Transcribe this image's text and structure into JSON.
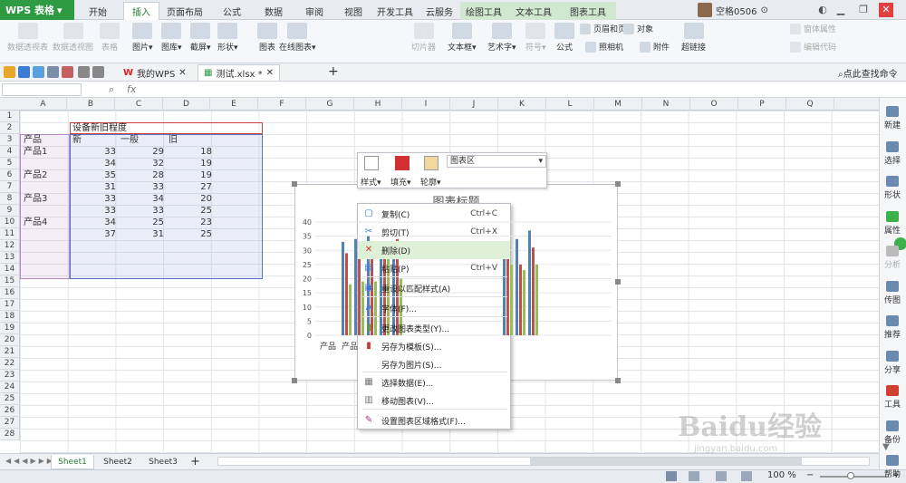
{
  "app": {
    "brand": "WPS 表格",
    "menu_arrow": "▾"
  },
  "tabs": [
    "开始",
    "插入",
    "页面布局",
    "公式",
    "数据",
    "审阅",
    "视图",
    "开发工具",
    "云服务",
    "绘图工具",
    "文本工具",
    "图表工具"
  ],
  "active_tab": "插入",
  "user": {
    "name": "空格0506"
  },
  "ribbon": {
    "buttons": [
      "数据透视表",
      "数据透视图",
      "表格",
      "图片▾",
      "图库▾",
      "截屏▾",
      "形状▾",
      "图表",
      "在线图表▾",
      "切片器",
      "文本框▾",
      "艺术字▾",
      "符号▾",
      "公式",
      "页眉和页脚",
      "对象",
      "照相机",
      "附件",
      "超链接",
      "窗体属性",
      "编辑代码"
    ]
  },
  "quickbar": {
    "doc_tabs": [
      {
        "label": "我的WPS"
      },
      {
        "label": "测试.xlsx *"
      }
    ],
    "search": "点此查找命令"
  },
  "formula": {
    "fx": "fx"
  },
  "columns": [
    "A",
    "B",
    "C",
    "D",
    "E",
    "F",
    "G",
    "H",
    "I",
    "J",
    "K",
    "L",
    "M",
    "N",
    "O",
    "P",
    "Q"
  ],
  "rows": [
    "1",
    "2",
    "3",
    "4",
    "5",
    "6",
    "7",
    "8",
    "9",
    "10",
    "11",
    "12",
    "13",
    "14",
    "15",
    "16",
    "17",
    "18",
    "19",
    "20",
    "21",
    "22",
    "23",
    "24",
    "25",
    "26",
    "27",
    "28"
  ],
  "sheet": {
    "title": "设备新旧程度",
    "headers": [
      "产品",
      "新",
      "一般",
      "旧"
    ],
    "products": [
      "产品1",
      "产品2",
      "产品3",
      "产品4"
    ],
    "data": [
      [
        33,
        29,
        18
      ],
      [
        34,
        32,
        19
      ],
      [
        35,
        28,
        19
      ],
      [
        31,
        33,
        27
      ],
      [
        33,
        34,
        20
      ],
      [
        33,
        33,
        25
      ],
      [
        34,
        25,
        23
      ],
      [
        37,
        31,
        25
      ]
    ]
  },
  "chart": {
    "title": "图表标题",
    "ticks": [
      "40",
      "35",
      "30",
      "25",
      "20",
      "15",
      "10",
      "5",
      "0"
    ],
    "xlabels": [
      "产品",
      "产品"
    ]
  },
  "floatbar": {
    "style": "样式",
    "fill": "填充",
    "outline": "轮廓",
    "area": "图表区"
  },
  "context_menu": [
    {
      "label": "复制(C)",
      "shortcut": "Ctrl+C",
      "icon": "copy-icon"
    },
    {
      "label": "剪切(T)",
      "shortcut": "Ctrl+X",
      "icon": "cut-icon"
    },
    {
      "label": "删除(D)",
      "shortcut": "",
      "icon": "delete-icon"
    },
    {
      "label": "粘贴(P)",
      "shortcut": "Ctrl+V",
      "icon": "paste-icon"
    },
    {
      "label": "重设以匹配样式(A)",
      "shortcut": "",
      "icon": "reset-style-icon"
    },
    {
      "label": "字体(F)...",
      "shortcut": "",
      "icon": "font-icon"
    },
    {
      "label": "更改图表类型(Y)...",
      "shortcut": "",
      "icon": "chart-type-icon"
    },
    {
      "label": "另存为模板(S)...",
      "shortcut": "",
      "icon": "template-icon"
    },
    {
      "label": "另存为图片(S)...",
      "shortcut": "",
      "icon": ""
    },
    {
      "label": "选择数据(E)...",
      "shortcut": "",
      "icon": "select-data-icon"
    },
    {
      "label": "移动图表(V)...",
      "shortcut": "",
      "icon": "move-chart-icon"
    },
    {
      "label": "设置图表区域格式(F)...",
      "shortcut": "",
      "icon": "format-area-icon"
    }
  ],
  "sidebar": [
    "新建",
    "选择",
    "形状",
    "属性",
    "分析",
    "传图",
    "推荐",
    "分享",
    "工具",
    "备份",
    "帮助"
  ],
  "sheets": [
    "Sheet1",
    "Sheet2",
    "Sheet3"
  ],
  "status": {
    "zoom": "100 %"
  },
  "watermark": "Baidu经验",
  "watermark_sub": "jingyan.baidu.com",
  "colors": {
    "blue": "#4f81bd",
    "red": "#c0504d",
    "green": "#9bbb59",
    "accent": "#2e9b43"
  },
  "chart_data": {
    "type": "bar",
    "categories": [
      "产品1",
      "",
      "产品2",
      "",
      "产品3",
      "",
      "产品4",
      ""
    ],
    "series": [
      {
        "name": "新",
        "values": [
          33,
          34,
          35,
          31,
          33,
          33,
          34,
          37
        ]
      },
      {
        "name": "一般",
        "values": [
          29,
          32,
          28,
          33,
          34,
          33,
          25,
          31
        ]
      },
      {
        "name": "旧",
        "values": [
          18,
          19,
          19,
          27,
          20,
          25,
          23,
          25
        ]
      }
    ],
    "title": "图表标题",
    "ylim": [
      0,
      40
    ],
    "grid": true
  }
}
